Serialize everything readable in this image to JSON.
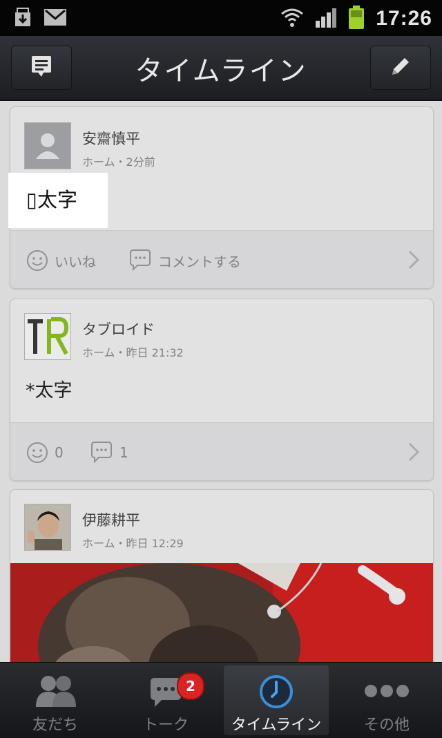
{
  "status_bar": {
    "time": "17:26",
    "icons": [
      "download-icon",
      "gmail-icon",
      "wifi-icon",
      "signal-icon",
      "battery-icon"
    ]
  },
  "header": {
    "title": "タイムライン",
    "left_button": "notes-icon",
    "right_button": "pencil-icon"
  },
  "posts": [
    {
      "author": "安齋慎平",
      "meta": "ホーム・2分前",
      "text": "▯太字",
      "like_label": "いいね",
      "comment_label": "コメントする"
    },
    {
      "author": "タブロイド",
      "meta": "ホーム・昨日 21:32",
      "text": "*太字",
      "like_count": "0",
      "comment_count": "1"
    },
    {
      "author": "伊藤耕平",
      "meta": "ホーム・昨日 12:29"
    }
  ],
  "tabs": [
    {
      "label": "友だち",
      "icon": "friends-icon"
    },
    {
      "label": "トーク",
      "icon": "talk-icon",
      "badge": "2"
    },
    {
      "label": "タイムライン",
      "icon": "clock-icon",
      "active": true
    },
    {
      "label": "その他",
      "icon": "more-icon"
    }
  ],
  "colors": {
    "accent_blue": "#3a8ed8",
    "badge_red": "#dd2222",
    "logo_green": "#8dc21f"
  }
}
